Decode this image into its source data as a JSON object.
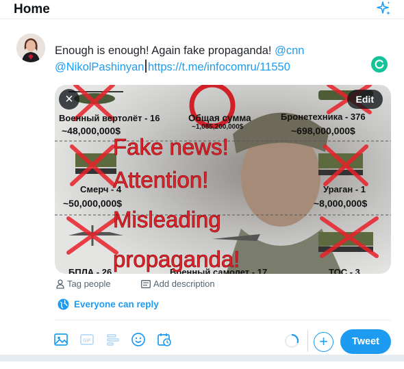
{
  "header": {
    "title": "Home",
    "sparkle_icon": "sparkle-icon"
  },
  "composer": {
    "text_main": "Enough is enough! Again fake propaganda!",
    "mention_cnn": "@cnn",
    "mention_pashinyan": "@NikolPashinyan",
    "link": "https://t.me/infocomru/11550"
  },
  "media": {
    "close_label": "×",
    "edit_label": "Edit",
    "image_text": {
      "helicopter": "Военный вертолёт - 16",
      "helicopter_cost": "~48,000,000$",
      "total": "Общая сумма",
      "total_cost": "~1,085,200,000$",
      "armor": "Бронетехника - 376",
      "armor_cost": "~698,000,000$",
      "smerch": "Смерч - 4",
      "smerch_cost": "~50,000,000$",
      "uragan": "Ураган - 1",
      "uragan_cost": "~8,000,000$",
      "uav": "БПЛА - 26",
      "plane": "Военный самолет - 17",
      "tos": "ТОС - 3",
      "overlay_1": "Fake news!",
      "overlay_2": "Attention!",
      "overlay_3": "Misleading",
      "overlay_4": "propaganda!"
    }
  },
  "media_actions": {
    "tag_people": "Tag people",
    "add_description": "Add description"
  },
  "reply_setting": "Everyone can reply",
  "toolbar": {
    "gif_label": "GIF",
    "tweet_label": "Tweet",
    "add_label": "+"
  },
  "colors": {
    "accent": "#1d9bf0",
    "overlay_red": "#e8222a"
  }
}
